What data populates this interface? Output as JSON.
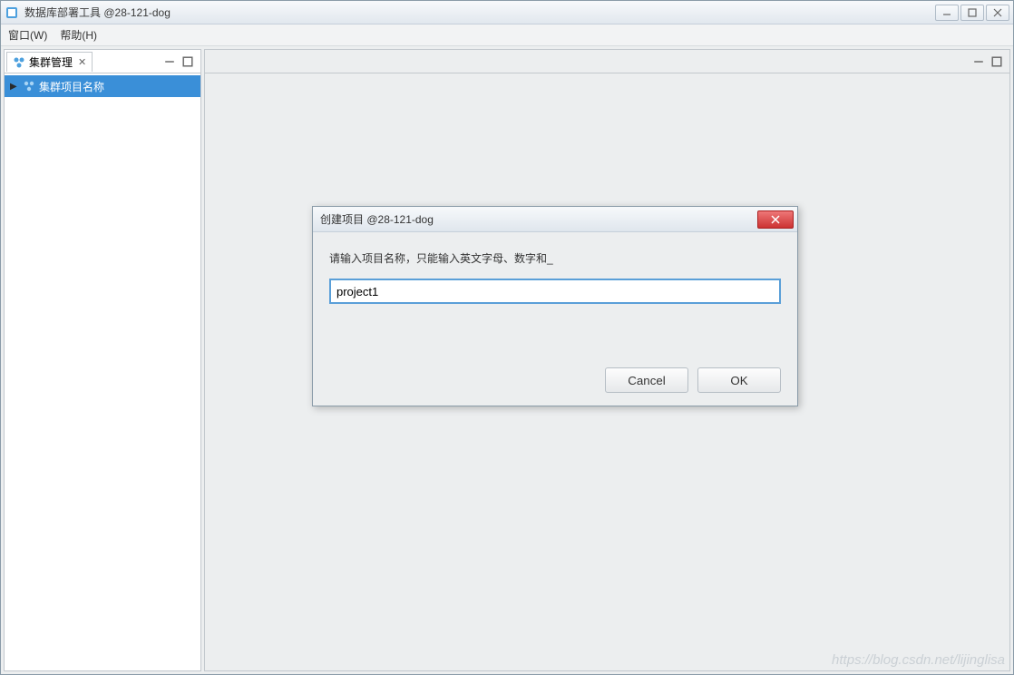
{
  "window": {
    "title": "数据库部署工具 @28-121-dog"
  },
  "menu": {
    "window": "窗口(W)",
    "help": "帮助(H)"
  },
  "sidebar": {
    "tab_label": "集群管理",
    "tree_item": "集群项目名称"
  },
  "dialog": {
    "title": "创建项目  @28-121-dog",
    "prompt": "请输入项目名称，只能输入英文字母、数字和_",
    "input_value": "project1",
    "cancel": "Cancel",
    "ok": "OK"
  },
  "watermark": "https://blog.csdn.net/lijinglisa"
}
